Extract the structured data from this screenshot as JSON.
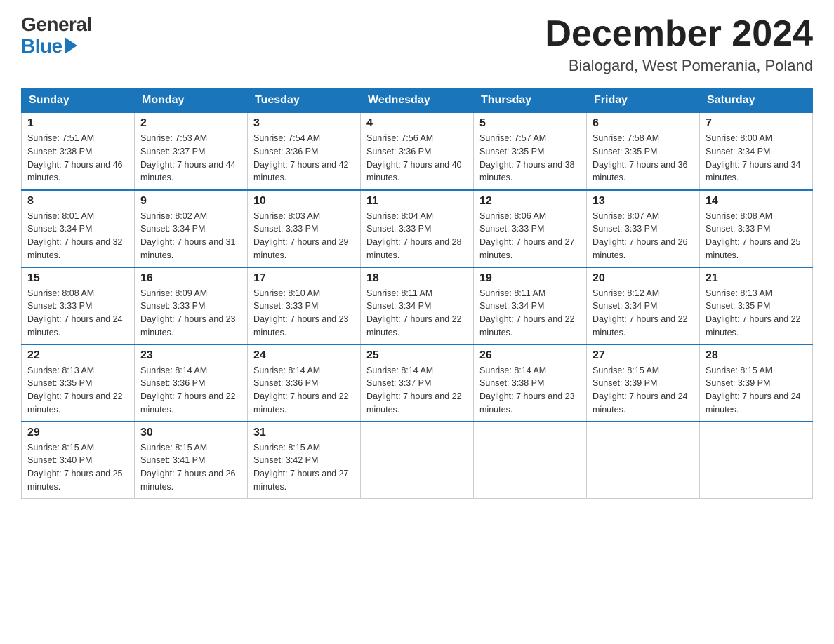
{
  "header": {
    "logo_general": "General",
    "logo_blue": "Blue",
    "month_title": "December 2024",
    "location": "Bialogard, West Pomerania, Poland"
  },
  "weekdays": [
    "Sunday",
    "Monday",
    "Tuesday",
    "Wednesday",
    "Thursday",
    "Friday",
    "Saturday"
  ],
  "weeks": [
    [
      {
        "day": "1",
        "sunrise": "7:51 AM",
        "sunset": "3:38 PM",
        "daylight": "7 hours and 46 minutes."
      },
      {
        "day": "2",
        "sunrise": "7:53 AM",
        "sunset": "3:37 PM",
        "daylight": "7 hours and 44 minutes."
      },
      {
        "day": "3",
        "sunrise": "7:54 AM",
        "sunset": "3:36 PM",
        "daylight": "7 hours and 42 minutes."
      },
      {
        "day": "4",
        "sunrise": "7:56 AM",
        "sunset": "3:36 PM",
        "daylight": "7 hours and 40 minutes."
      },
      {
        "day": "5",
        "sunrise": "7:57 AM",
        "sunset": "3:35 PM",
        "daylight": "7 hours and 38 minutes."
      },
      {
        "day": "6",
        "sunrise": "7:58 AM",
        "sunset": "3:35 PM",
        "daylight": "7 hours and 36 minutes."
      },
      {
        "day": "7",
        "sunrise": "8:00 AM",
        "sunset": "3:34 PM",
        "daylight": "7 hours and 34 minutes."
      }
    ],
    [
      {
        "day": "8",
        "sunrise": "8:01 AM",
        "sunset": "3:34 PM",
        "daylight": "7 hours and 32 minutes."
      },
      {
        "day": "9",
        "sunrise": "8:02 AM",
        "sunset": "3:34 PM",
        "daylight": "7 hours and 31 minutes."
      },
      {
        "day": "10",
        "sunrise": "8:03 AM",
        "sunset": "3:33 PM",
        "daylight": "7 hours and 29 minutes."
      },
      {
        "day": "11",
        "sunrise": "8:04 AM",
        "sunset": "3:33 PM",
        "daylight": "7 hours and 28 minutes."
      },
      {
        "day": "12",
        "sunrise": "8:06 AM",
        "sunset": "3:33 PM",
        "daylight": "7 hours and 27 minutes."
      },
      {
        "day": "13",
        "sunrise": "8:07 AM",
        "sunset": "3:33 PM",
        "daylight": "7 hours and 26 minutes."
      },
      {
        "day": "14",
        "sunrise": "8:08 AM",
        "sunset": "3:33 PM",
        "daylight": "7 hours and 25 minutes."
      }
    ],
    [
      {
        "day": "15",
        "sunrise": "8:08 AM",
        "sunset": "3:33 PM",
        "daylight": "7 hours and 24 minutes."
      },
      {
        "day": "16",
        "sunrise": "8:09 AM",
        "sunset": "3:33 PM",
        "daylight": "7 hours and 23 minutes."
      },
      {
        "day": "17",
        "sunrise": "8:10 AM",
        "sunset": "3:33 PM",
        "daylight": "7 hours and 23 minutes."
      },
      {
        "day": "18",
        "sunrise": "8:11 AM",
        "sunset": "3:34 PM",
        "daylight": "7 hours and 22 minutes."
      },
      {
        "day": "19",
        "sunrise": "8:11 AM",
        "sunset": "3:34 PM",
        "daylight": "7 hours and 22 minutes."
      },
      {
        "day": "20",
        "sunrise": "8:12 AM",
        "sunset": "3:34 PM",
        "daylight": "7 hours and 22 minutes."
      },
      {
        "day": "21",
        "sunrise": "8:13 AM",
        "sunset": "3:35 PM",
        "daylight": "7 hours and 22 minutes."
      }
    ],
    [
      {
        "day": "22",
        "sunrise": "8:13 AM",
        "sunset": "3:35 PM",
        "daylight": "7 hours and 22 minutes."
      },
      {
        "day": "23",
        "sunrise": "8:14 AM",
        "sunset": "3:36 PM",
        "daylight": "7 hours and 22 minutes."
      },
      {
        "day": "24",
        "sunrise": "8:14 AM",
        "sunset": "3:36 PM",
        "daylight": "7 hours and 22 minutes."
      },
      {
        "day": "25",
        "sunrise": "8:14 AM",
        "sunset": "3:37 PM",
        "daylight": "7 hours and 22 minutes."
      },
      {
        "day": "26",
        "sunrise": "8:14 AM",
        "sunset": "3:38 PM",
        "daylight": "7 hours and 23 minutes."
      },
      {
        "day": "27",
        "sunrise": "8:15 AM",
        "sunset": "3:39 PM",
        "daylight": "7 hours and 24 minutes."
      },
      {
        "day": "28",
        "sunrise": "8:15 AM",
        "sunset": "3:39 PM",
        "daylight": "7 hours and 24 minutes."
      }
    ],
    [
      {
        "day": "29",
        "sunrise": "8:15 AM",
        "sunset": "3:40 PM",
        "daylight": "7 hours and 25 minutes."
      },
      {
        "day": "30",
        "sunrise": "8:15 AM",
        "sunset": "3:41 PM",
        "daylight": "7 hours and 26 minutes."
      },
      {
        "day": "31",
        "sunrise": "8:15 AM",
        "sunset": "3:42 PM",
        "daylight": "7 hours and 27 minutes."
      },
      null,
      null,
      null,
      null
    ]
  ]
}
